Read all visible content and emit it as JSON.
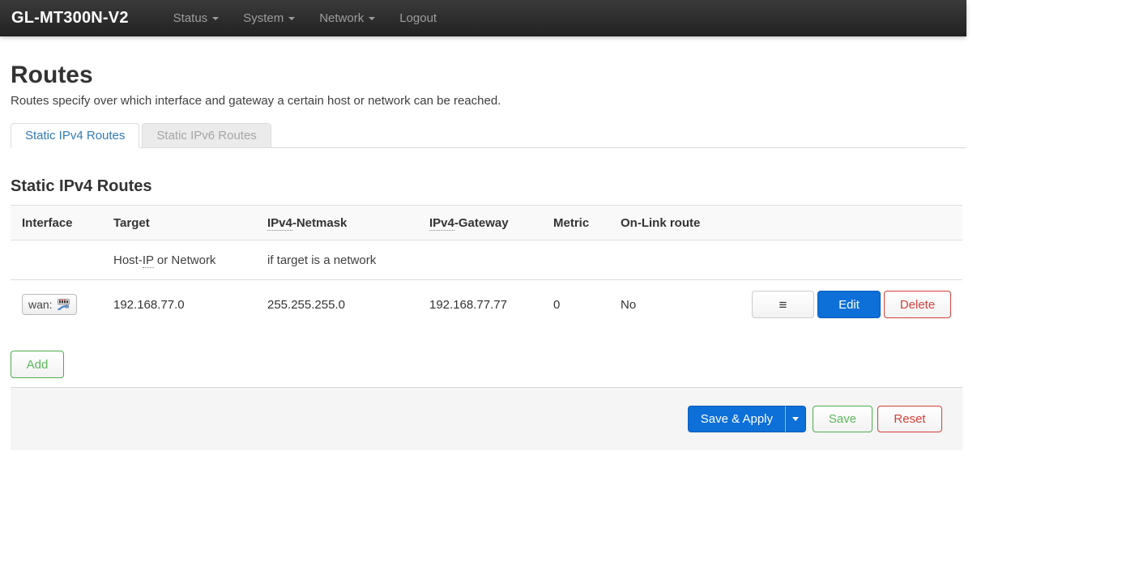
{
  "navbar": {
    "brand": "GL-MT300N-V2",
    "items": [
      {
        "label": "Status"
      },
      {
        "label": "System"
      },
      {
        "label": "Network"
      },
      {
        "label": "Logout"
      }
    ]
  },
  "page": {
    "title": "Routes",
    "description": "Routes specify over which interface and gateway a certain host or network can be reached."
  },
  "tabs": [
    {
      "label": "Static IPv4 Routes",
      "state": "active"
    },
    {
      "label": "Static IPv6 Routes",
      "state": "inactive"
    }
  ],
  "section_title": "Static IPv4 Routes",
  "table": {
    "headers": {
      "interface": "Interface",
      "target": "Target",
      "netmask_abbr": "IPv4",
      "netmask_rest": "-Netmask",
      "gateway_abbr": "IPv4",
      "gateway_rest": "-Gateway",
      "metric": "Metric",
      "onlink": "On-Link route"
    },
    "hints": {
      "target_pre": "Host-",
      "target_abbr": "IP",
      "target_rest": " or Network",
      "netmask": "if target is a network"
    },
    "rows": [
      {
        "interface_label": "wan:",
        "interface_icon": "ethernet-switch-icon",
        "target": "192.168.77.0",
        "netmask": "255.255.255.0",
        "gateway": "192.168.77.77",
        "metric": "0",
        "onlink": "No"
      }
    ]
  },
  "buttons": {
    "sort_glyph": "≡",
    "edit": "Edit",
    "delete": "Delete",
    "add": "Add",
    "save_apply": "Save & Apply",
    "save": "Save",
    "reset": "Reset"
  },
  "colors": {
    "primary_blue": "#0d6fd8",
    "green": "#5cb85c",
    "red": "#d43f3a",
    "tab_active_blue": "#337ab7",
    "navbar_bg": "#222222"
  }
}
